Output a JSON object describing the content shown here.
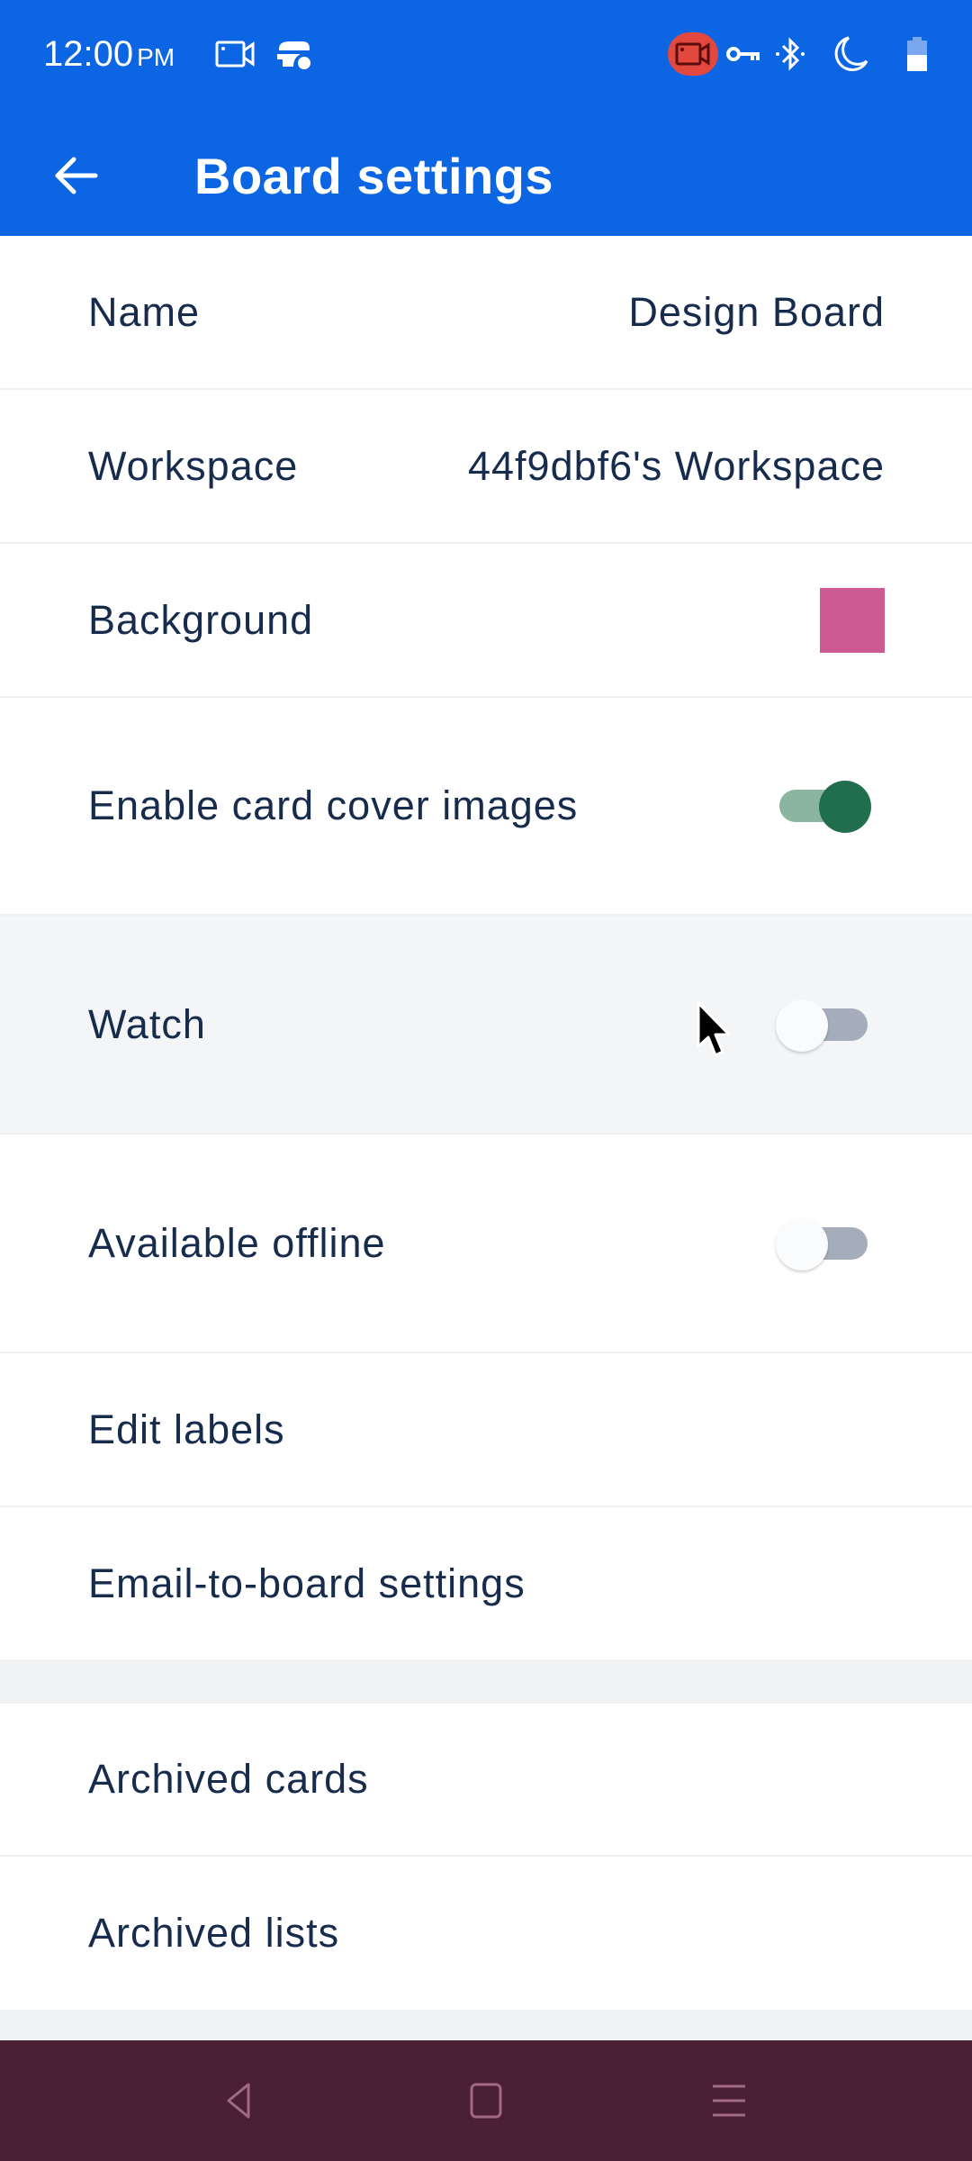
{
  "status_bar": {
    "time": "12:00",
    "ampm": "PM",
    "icons": [
      "screen-record-icon",
      "cast-icon",
      "recording-active-icon",
      "vpn-key-icon",
      "bluetooth-icon",
      "do-not-disturb-moon-icon",
      "battery-icon"
    ]
  },
  "app_bar": {
    "title": "Board settings",
    "back_icon": "arrow-left-icon"
  },
  "settings": {
    "name": {
      "label": "Name",
      "value": "Design Board"
    },
    "workspace": {
      "label": "Workspace",
      "value": "44f9dbf6's Workspace"
    },
    "background": {
      "label": "Background",
      "color": "#cd5a91"
    },
    "card_covers": {
      "label": "Enable card cover images",
      "enabled": true
    },
    "watch": {
      "label": "Watch",
      "enabled": false
    },
    "offline": {
      "label": "Available offline",
      "enabled": false
    },
    "edit_labels": {
      "label": "Edit labels"
    },
    "email_to_board": {
      "label": "Email-to-board settings"
    }
  },
  "archive": {
    "cards": {
      "label": "Archived cards"
    },
    "lists": {
      "label": "Archived lists"
    }
  },
  "nav_bar": {
    "buttons": [
      "back-triangle-icon",
      "home-square-icon",
      "recents-menu-icon"
    ]
  },
  "colors": {
    "brand_blue": "#0c66e4",
    "toggle_on": "#216e4e",
    "toggle_off_track": "#a5adba",
    "text": "#172b4d",
    "nav_bar": "#4a1f33"
  }
}
